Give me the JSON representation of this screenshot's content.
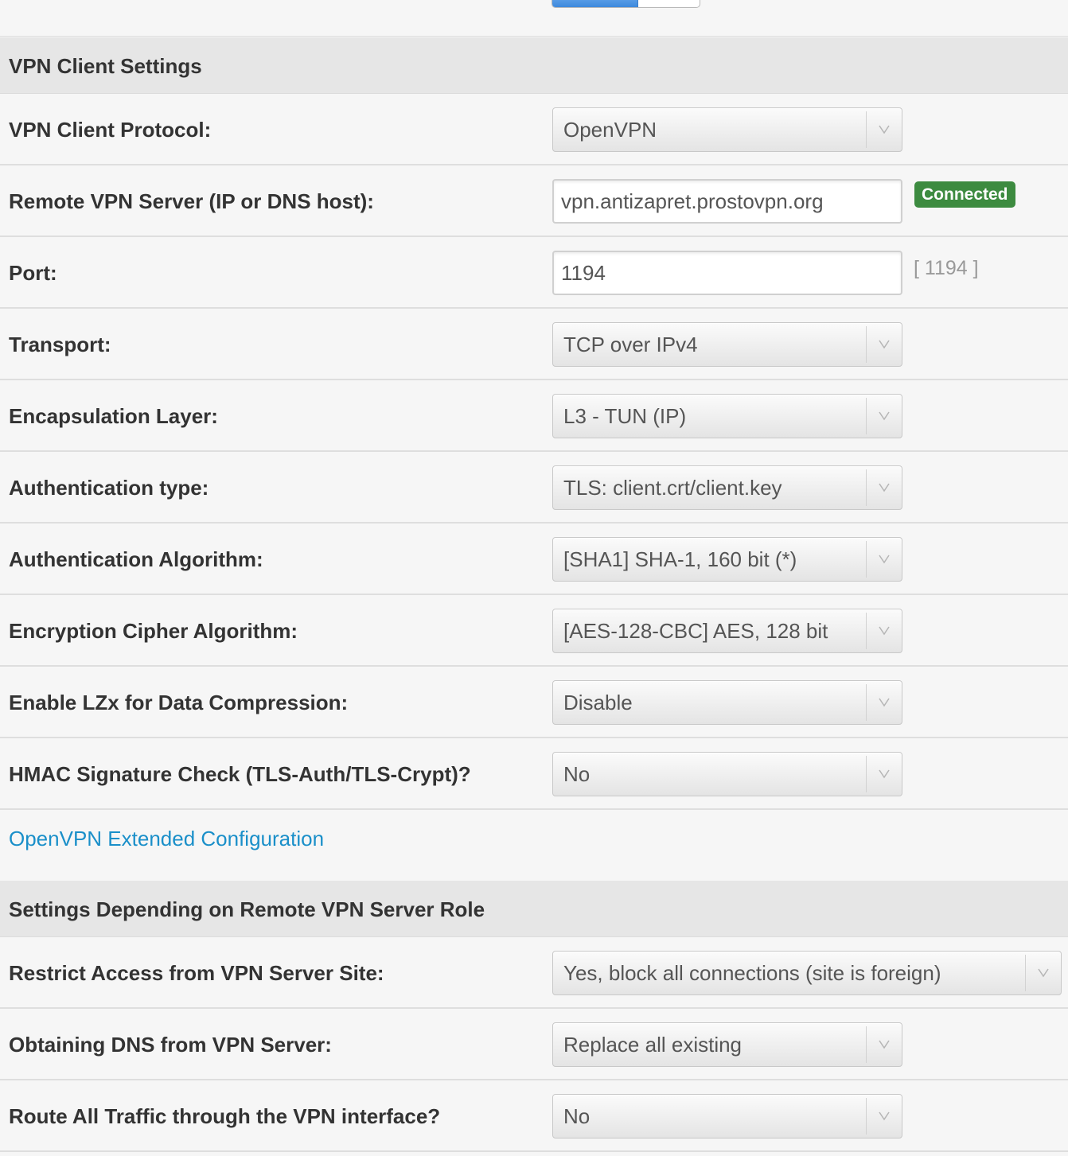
{
  "sections": {
    "vpn_client_settings": "VPN Client Settings",
    "server_role": "Settings Depending on Remote VPN Server Role"
  },
  "fields": {
    "protocol": {
      "label": "VPN Client Protocol:",
      "value": "OpenVPN"
    },
    "remote_server": {
      "label": "Remote VPN Server (IP or DNS host):",
      "value": "vpn.antizapret.prostovpn.org",
      "status": "Connected"
    },
    "port": {
      "label": "Port:",
      "value": "1194",
      "hint": "[ 1194 ]"
    },
    "transport": {
      "label": "Transport:",
      "value": "TCP over IPv4"
    },
    "encapsulation": {
      "label": "Encapsulation Layer:",
      "value": "L3 - TUN (IP)"
    },
    "auth_type": {
      "label": "Authentication type:",
      "value": "TLS: client.crt/client.key"
    },
    "auth_algorithm": {
      "label": "Authentication Algorithm:",
      "value": "[SHA1] SHA-1, 160 bit (*)"
    },
    "cipher": {
      "label": "Encryption Cipher Algorithm:",
      "value": "[AES-128-CBC] AES, 128 bit"
    },
    "compression": {
      "label": "Enable LZx for Data Compression:",
      "value": "Disable"
    },
    "hmac": {
      "label": "HMAC Signature Check (TLS-Auth/TLS-Crypt)?",
      "value": "No"
    },
    "restrict_access": {
      "label": "Restrict Access from VPN Server Site:",
      "value": "Yes, block all connections (site is foreign)"
    },
    "dns": {
      "label": "Obtaining DNS from VPN Server:",
      "value": "Replace all existing"
    },
    "route_all": {
      "label": "Route All Traffic through the VPN interface?",
      "value": "No"
    }
  },
  "links": {
    "extended_config": "OpenVPN Extended Configuration"
  },
  "colors": {
    "status_connected": "#3d8b40",
    "link": "#1a8fc9",
    "section_bg": "#e6e6e6"
  }
}
